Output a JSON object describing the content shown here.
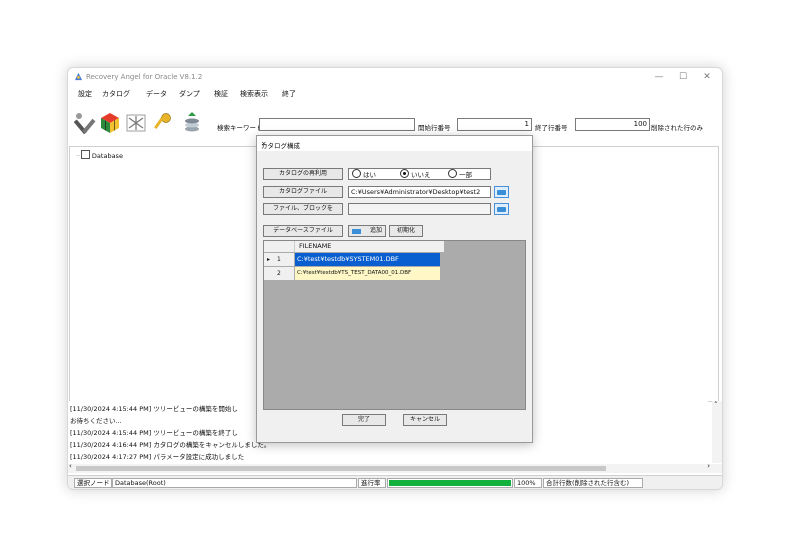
{
  "window": {
    "title": "Recovery Angel for Oracle V8.1.2",
    "controls": [
      "—",
      "☐",
      "✕"
    ]
  },
  "menu": [
    "設定",
    "カタログ",
    "データ",
    "ダンプ",
    "検証",
    "検索表示",
    "終了"
  ],
  "toolbar": {
    "search_keyword_label": "検索キーワード",
    "search_keyword_value": "",
    "start_row_label": "開始行番号",
    "start_row_value": "1",
    "end_row_label": "終了行番号",
    "end_row_value": "100",
    "deleted_rows_only_label": "削除された行のみ",
    "icons": [
      "tools-icon",
      "cube-icon",
      "shuffle-icon",
      "key-icon",
      "coins-icon"
    ]
  },
  "tree": {
    "root_label": "Database"
  },
  "log": [
    "[11/30/2024 4:15:44 PM] ツリービューの構築を開始し",
    "お待ちください...",
    "[11/30/2024 4:15:44 PM] ツリービューの構築を終了し",
    "[11/30/2024 4:16:44 PM] カタログの構築をキャンセルしました。",
    "[11/30/2024 4:17:27 PM] パラメータ設定に成功しました"
  ],
  "status": {
    "selected_node_label": "選択ノード",
    "selected_node_value": "Database(Root)",
    "progress_label": "進行率",
    "progress_value": 100,
    "progress_text": "100%",
    "total_rows_label": "合計行数(削除された行含む)"
  },
  "dialog": {
    "title": "カタログ構成",
    "reuse_label": "カタログの再利用",
    "radio_options": [
      "はい",
      "いいえ",
      "一部"
    ],
    "radio_selected": 1,
    "catalog_file_label": "カタログファイル",
    "catalog_file_value": "C:¥Users¥Administrator¥Desktop¥test2",
    "file_block_label": "ファイル、ブロックを",
    "file_block_value": "",
    "db_file_label": "データベースファイル",
    "add_button": "追加",
    "init_button": "初期化",
    "grid_header": "FILENAME",
    "rows": [
      {
        "num": "1",
        "filename": "C:¥test¥testdb¥SYSTEM01.DBF",
        "selected": true
      },
      {
        "num": "2",
        "filename": "C:¥test¥testdb¥TS_TEST_DATA00_01.DBF",
        "selected": false
      }
    ],
    "ok_button": "完了",
    "cancel_button": "キャンセル"
  },
  "colors": {
    "selection": "#0a5fd0",
    "row_highlight": "#fff8c6",
    "progress": "#12b03c"
  }
}
